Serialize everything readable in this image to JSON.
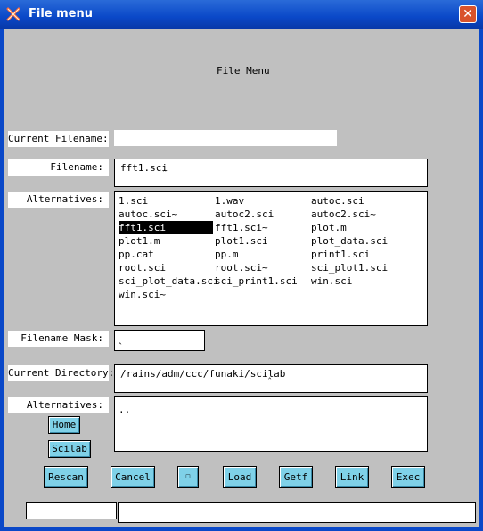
{
  "window": {
    "title": "File menu"
  },
  "header": {
    "text": "File Menu"
  },
  "fields": {
    "current_filename_label": "Current Filename:",
    "current_filename_value": "",
    "filename_label": "Filename:",
    "filename_value": "fft1.sci",
    "alternatives_label": "Alternatives:",
    "filename_mask_label": "Filename Mask:",
    "filename_mask_value": "",
    "current_directory_label": "Current Directory:",
    "current_directory_value": "/rains/adm/ccc/funaki/scilab",
    "dir_alternatives_label": "Alternatives:"
  },
  "file_alternatives": [
    "1.sci",
    "1.wav",
    "autoc.sci",
    "autoc.sci~",
    "autoc2.sci",
    "autoc2.sci~",
    "fft1.sci",
    "fft1.sci~",
    "plot.m",
    "plot1.m",
    "plot1.sci",
    "plot_data.sci",
    "pp.cat",
    "pp.m",
    "print1.sci",
    "root.sci",
    "root.sci~",
    "sci_plot1.sci",
    "sci_plot_data.sci",
    "sci_print1.sci",
    "win.sci",
    "win.sci~"
  ],
  "selected_file": "fft1.sci",
  "dir_alternatives": [
    ".."
  ],
  "buttons": {
    "home": "Home",
    "scilab": "Scilab",
    "rescan": "Rescan",
    "cancel": "Cancel",
    "unknown": "☐",
    "load": "Load",
    "getf": "Getf",
    "link": "Link",
    "exec": "Exec"
  },
  "status": {
    "left": "",
    "right": ""
  },
  "colors": {
    "titlebar": "#0a48c8",
    "button": "#7fd1e8",
    "background": "#c0c0c0",
    "close": "#d9532c"
  }
}
